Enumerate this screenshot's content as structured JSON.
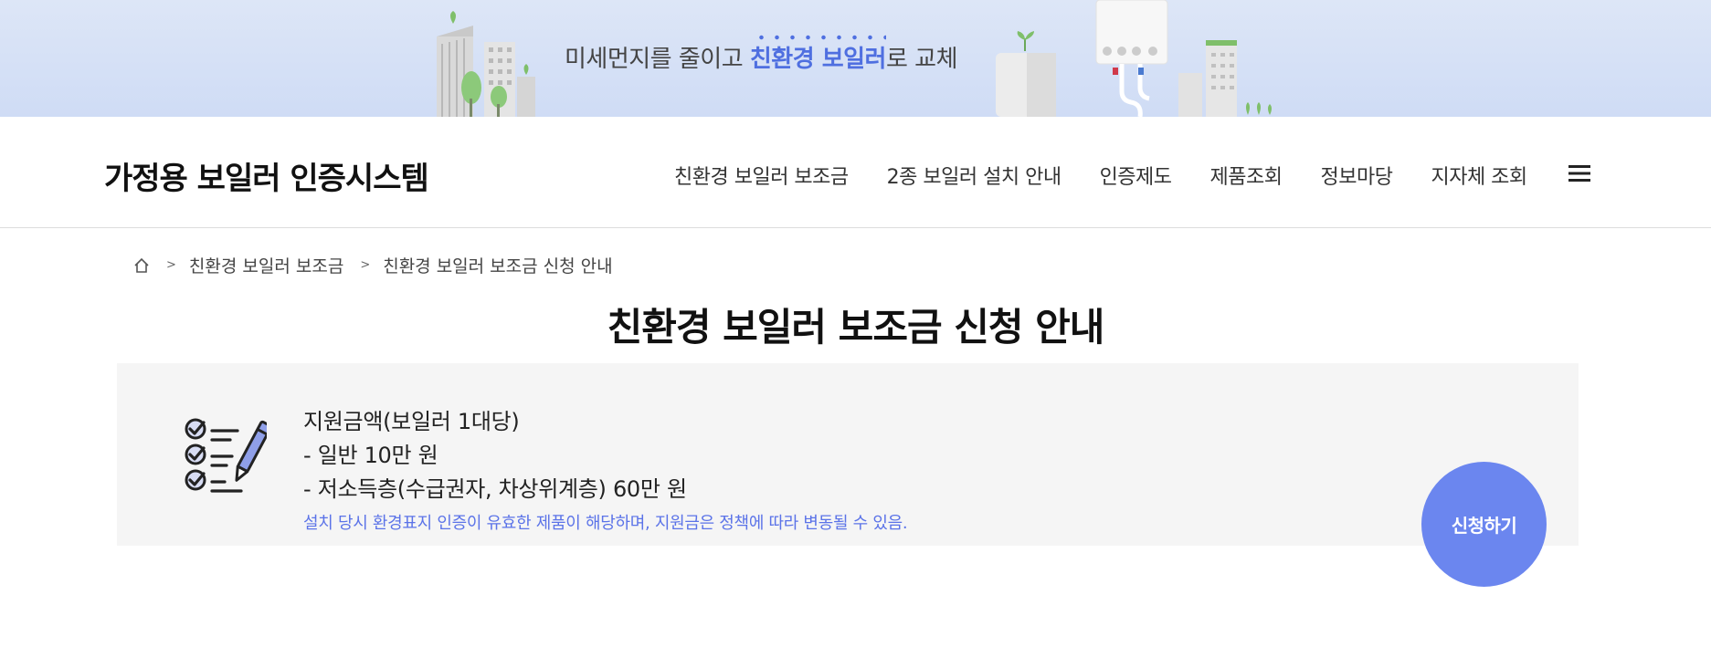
{
  "banner": {
    "text_before": "미세먼지를 줄이고 ",
    "text_highlight": "친환경 보일러",
    "text_after": "로 교체"
  },
  "header": {
    "site_title": "가정용 보일러 인증시스템",
    "nav": [
      {
        "label": "친환경 보일러 보조금"
      },
      {
        "label": "2종 보일러 설치 안내"
      },
      {
        "label": "인증제도"
      },
      {
        "label": "제품조회"
      },
      {
        "label": "정보마당"
      },
      {
        "label": "지자체 조회"
      }
    ],
    "menu_icon": "hamburger-icon"
  },
  "breadcrumb": {
    "home_icon": "home-icon",
    "separator": ">",
    "items": [
      "친환경 보일러 보조금",
      "친환경 보일러 보조금 신청 안내"
    ]
  },
  "page": {
    "title": "친환경 보일러 보조금 신청 안내"
  },
  "info": {
    "icon": "checklist-pencil-icon",
    "heading": "지원금액(보일러 1대당)",
    "lines": [
      "- 일반 10만 원",
      "- 저소득층(수급권자, 차상위계층) 60만 원"
    ],
    "note": "설치 당시 환경표지 인증이 유효한 제품이 해당하며, 지원금은 정책에 따라 변동될 수 있음.",
    "note_color": "#5b73e8"
  },
  "actions": {
    "apply_label": "신청하기",
    "apply_color": "#6b86ef"
  }
}
